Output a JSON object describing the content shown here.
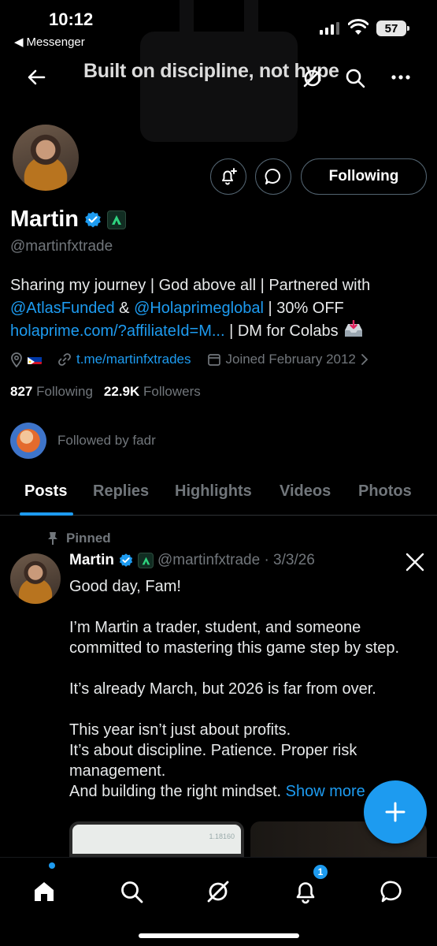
{
  "status_bar": {
    "time": "10:12",
    "back_app": "Messenger",
    "battery": "57"
  },
  "banner": {
    "text": "Built on discipline, not hype"
  },
  "profile": {
    "following_button": "Following",
    "name": "Martin",
    "handle": "@martinfxtrade",
    "bio": {
      "part1": "Sharing my journey | God above all | Partnered with ",
      "mention1": "@AtlasFunded",
      "part2": " & ",
      "mention2": "@Holaprimeglobal",
      "part3": " | 30% OFF ",
      "link": "holaprime.com/?affiliateId=M...",
      "part4": " | DM for Colabs "
    },
    "website": "t.me/martinfxtrades",
    "joined": "Joined February 2012",
    "following_count": "827",
    "following_label": "Following",
    "followers_count": "22.9K",
    "followers_label": "Followers",
    "followed_by": "Followed by fadr"
  },
  "tabs": [
    "Posts",
    "Replies",
    "Highlights",
    "Videos",
    "Photos"
  ],
  "post": {
    "pinned_label": "Pinned",
    "author": "Martin",
    "handle_date": "@martinfxtrade · 3/3/26",
    "lines": [
      "Good day, Fam!",
      "",
      "I’m Martin a trader, student, and someone committed to mastering this game step by step.",
      "",
      "It’s already March, but 2026 is far from over.",
      "",
      "This year isn’t just about profits.",
      "It’s about discipline. Patience. Proper risk management.",
      "And building the right mindset. "
    ],
    "show_more": "Show more",
    "media_label": "1.18160"
  },
  "bottom_nav": {
    "notification_count": "1"
  },
  "colors": {
    "accent": "#1d9bf0",
    "muted": "#71767b",
    "background": "#000000"
  }
}
